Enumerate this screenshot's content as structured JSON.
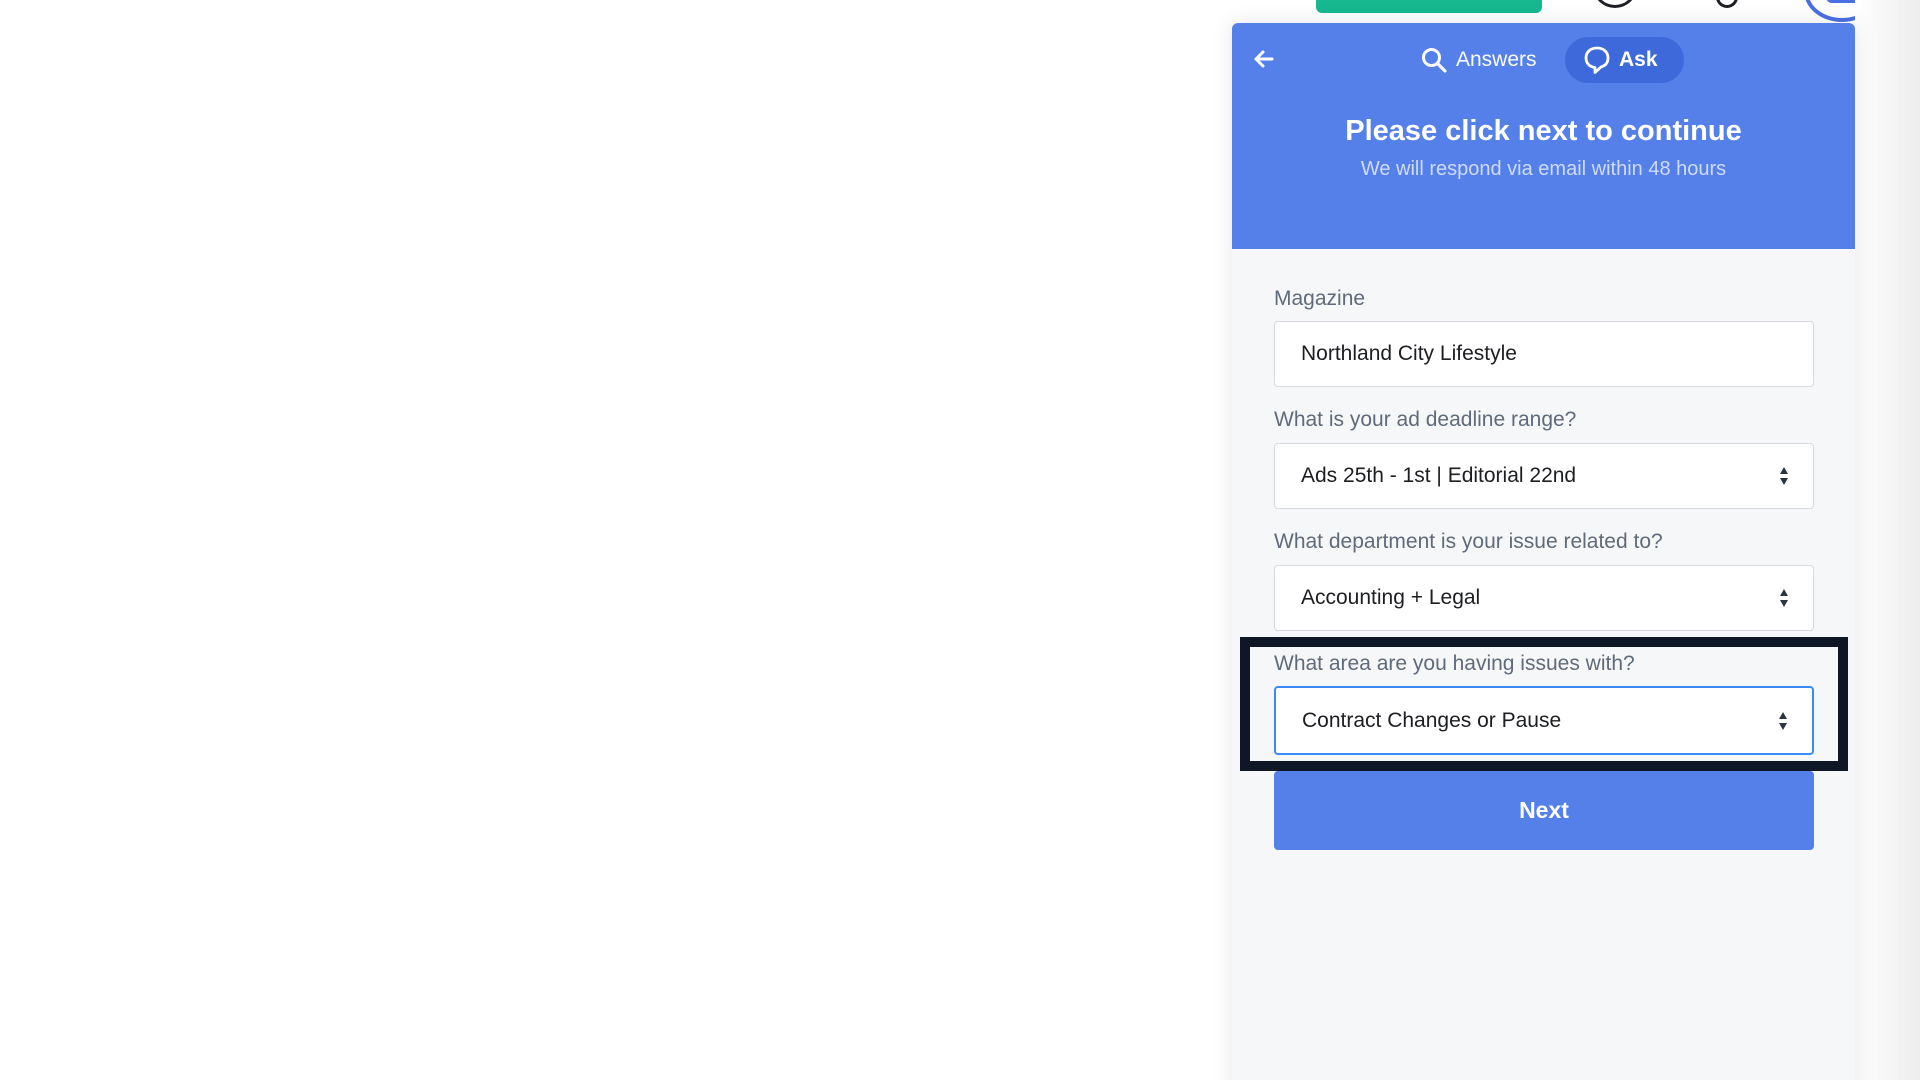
{
  "colors": {
    "brand_blue": "#5580e9",
    "ask_tab_bg": "#3e69da",
    "focus_border": "#3b8cf2",
    "highlight_frame": "#0f1626",
    "top_green": "#17b890"
  },
  "header": {
    "back_icon": "arrow-left-icon",
    "tabs": [
      {
        "label": "Answers",
        "icon": "search-icon",
        "active": false
      },
      {
        "label": "Ask",
        "icon": "chat-bubble-icon",
        "active": true
      }
    ],
    "title": "Please click next to continue",
    "subtitle": "We will respond via email within 48 hours"
  },
  "form": {
    "magazine": {
      "label": "Magazine",
      "value": "Northland City Lifestyle"
    },
    "deadline": {
      "label": "What is your ad deadline range?",
      "value": "Ads 25th - 1st | Editorial 22nd"
    },
    "department": {
      "label": "What department is your issue related to?",
      "value": "Accounting + Legal"
    },
    "issue_area": {
      "label": "What area are you having issues with?",
      "value": "Contract Changes or Pause"
    },
    "next_label": "Next"
  }
}
